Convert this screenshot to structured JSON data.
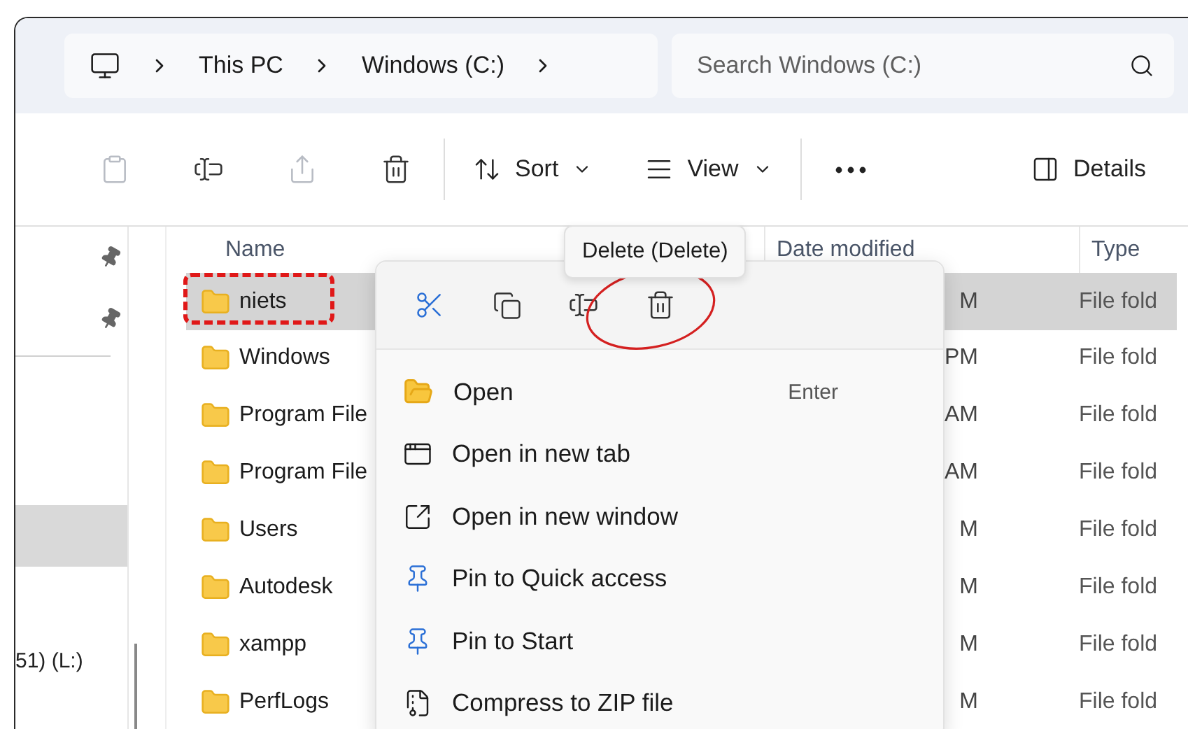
{
  "address": {
    "crumbs": [
      "This PC",
      "Windows (C:)"
    ]
  },
  "search": {
    "placeholder": "Search Windows (C:)"
  },
  "toolbar": {
    "actions": [
      {
        "kind": "paste",
        "disabled": true
      },
      {
        "kind": "rename",
        "disabled": false
      },
      {
        "kind": "share",
        "disabled": true
      },
      {
        "kind": "delete",
        "disabled": false
      }
    ],
    "sort": "Sort",
    "view": "View",
    "details": "Details"
  },
  "sidebar": {
    "rows": [
      {
        "kind": "pinned",
        "selected": false
      },
      {
        "kind": "pinned",
        "selected": false
      },
      {
        "kind": "blank",
        "selected": true
      },
      {
        "kind": "drive",
        "label": "51) (L:)",
        "selected": false
      }
    ]
  },
  "table": {
    "columns": [
      "Name",
      "Date modified",
      "Type"
    ],
    "rows": [
      {
        "name": "niets",
        "date": "M",
        "type": "File fold",
        "selected": true
      },
      {
        "name": "Windows",
        "date": "PM",
        "type": "File fold",
        "selected": false
      },
      {
        "name": "Program File",
        "date": "AM",
        "type": "File fold",
        "selected": false
      },
      {
        "name": "Program File",
        "date": "AM",
        "type": "File fold",
        "selected": false
      },
      {
        "name": "Users",
        "date": "M",
        "type": "File fold",
        "selected": false
      },
      {
        "name": "Autodesk",
        "date": "M",
        "type": "File fold",
        "selected": false
      },
      {
        "name": "xampp",
        "date": "M",
        "type": "File fold",
        "selected": false
      },
      {
        "name": "PerfLogs",
        "date": "M",
        "type": "File fold",
        "selected": false
      }
    ]
  },
  "context_menu": {
    "quick_actions": [
      {
        "kind": "cut"
      },
      {
        "kind": "copy"
      },
      {
        "kind": "rename"
      },
      {
        "kind": "delete"
      }
    ],
    "items": [
      {
        "kind": "open",
        "label": "Open",
        "shortcut": "Enter"
      },
      {
        "kind": "tab",
        "label": "Open in new tab"
      },
      {
        "kind": "window",
        "label": "Open in new window"
      },
      {
        "kind": "pin",
        "label": "Pin to Quick access"
      },
      {
        "kind": "pin",
        "label": "Pin to Start"
      },
      {
        "kind": "zip",
        "label": "Compress to ZIP file"
      }
    ]
  },
  "tooltip": {
    "text": "Delete (Delete)"
  }
}
